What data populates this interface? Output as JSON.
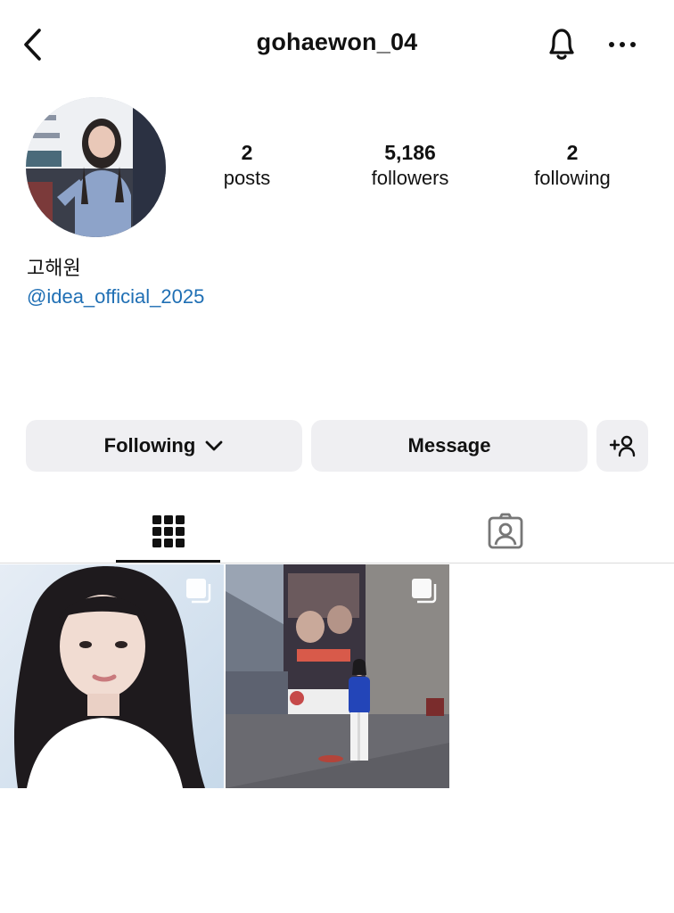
{
  "header": {
    "username": "gohaewon_04",
    "back_icon": "chevron-left-icon",
    "bell_icon": "bell-icon",
    "more_icon": "more-horizontal-icon"
  },
  "profile": {
    "stats": [
      {
        "value": "2",
        "label": "posts"
      },
      {
        "value": "5,186",
        "label": "followers"
      },
      {
        "value": "2",
        "label": "following"
      }
    ],
    "display_name": "고해원",
    "bio_link": "@idea_official_2025"
  },
  "actions": {
    "following_label": "Following",
    "message_label": "Message",
    "add_user_icon": "add-user-icon"
  },
  "tabs": {
    "grid_icon": "grid-icon",
    "tagged_icon": "tagged-user-icon",
    "active": "grid"
  },
  "posts": [
    {
      "type": "carousel",
      "icon": "carousel-icon"
    },
    {
      "type": "carousel",
      "icon": "carousel-icon"
    }
  ],
  "colors": {
    "link": "#1f6fb4",
    "button_bg": "#efeff2",
    "divider": "#dbdbdb"
  }
}
